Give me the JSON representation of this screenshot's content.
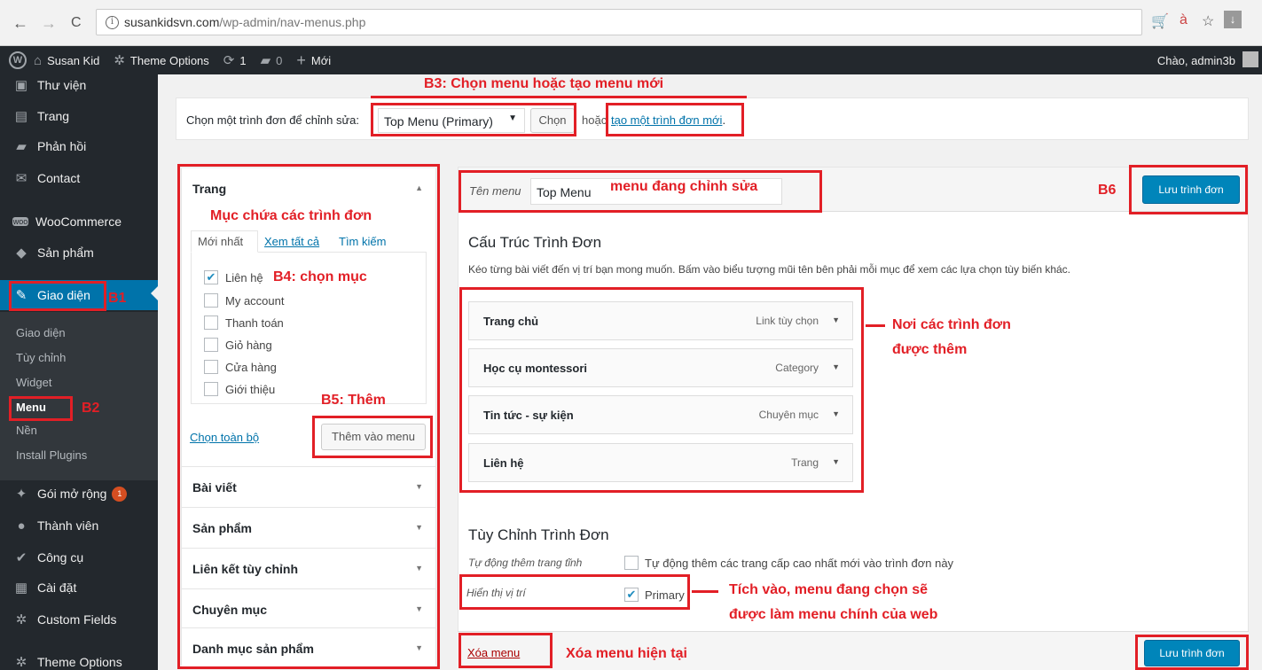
{
  "browser": {
    "back": "←",
    "forward": "→",
    "reload": "C",
    "info": "i",
    "url_host": "susankidsvn.com",
    "url_path": "/wp-admin/nav-menus.php"
  },
  "adminbar": {
    "site_name": "Susan Kid",
    "theme_options": "Theme Options",
    "updates": "1",
    "comments": "0",
    "new_label": "Mới",
    "greeting": "Chào, admin3b"
  },
  "sidebar": {
    "items": [
      {
        "label": "Thư viện",
        "icon": "media-icon"
      },
      {
        "label": "Trang",
        "icon": "page-icon"
      },
      {
        "label": "Phản hồi",
        "icon": "comment-icon"
      },
      {
        "label": "Contact",
        "icon": "mail-icon"
      },
      {
        "label": "WooCommerce",
        "icon": "woo-icon"
      },
      {
        "label": "Sản phẩm",
        "icon": "product-icon"
      },
      {
        "label": "Giao diện",
        "icon": "brush-icon"
      },
      {
        "label": "Gói mở rộng",
        "icon": "plugin-icon"
      },
      {
        "label": "Thành viên",
        "icon": "users-icon"
      },
      {
        "label": "Công cụ",
        "icon": "wrench-icon"
      },
      {
        "label": "Cài đặt",
        "icon": "settings-icon"
      },
      {
        "label": "Custom Fields",
        "icon": "gear-icon"
      },
      {
        "label": "Theme Options",
        "icon": "gear-icon"
      }
    ],
    "plugins_badge": "1",
    "submenu": [
      "Giao diện",
      "Tùy chỉnh",
      "Widget",
      "Menu",
      "Nền",
      "Install Plugins"
    ]
  },
  "select_bar": {
    "label": "Chọn một trình đơn để chỉnh sửa:",
    "selected": "Top Menu (Primary)",
    "button": "Chọn",
    "or_text": "hoặc",
    "create_link": "tạo một trình đơn mới",
    "period": "."
  },
  "left_panel": {
    "pages_title": "Trang",
    "tabs": [
      "Mới nhất",
      "Xem tất cả",
      "Tìm kiếm"
    ],
    "pages": [
      {
        "label": "Liên hệ",
        "checked": true
      },
      {
        "label": "My account",
        "checked": false
      },
      {
        "label": "Thanh toán",
        "checked": false
      },
      {
        "label": "Giỏ hàng",
        "checked": false
      },
      {
        "label": "Cửa hàng",
        "checked": false
      },
      {
        "label": "Giới thiệu",
        "checked": false
      }
    ],
    "select_all": "Chọn toàn bộ",
    "add_button": "Thêm vào menu",
    "sections": [
      "Bài viết",
      "Sản phẩm",
      "Liên kết tùy chỉnh",
      "Chuyên mục",
      "Danh mục sản phẩm"
    ]
  },
  "right_panel": {
    "menu_name_label": "Tên menu",
    "menu_name_value": "Top Menu",
    "save_button": "Lưu trình đơn",
    "structure_title": "Cấu Trúc Trình Đơn",
    "structure_desc": "Kéo từng bài viết đến vị trí bạn mong muốn. Bấm vào biểu tượng mũi tên bên phải mỗi mục để xem các lựa chọn tùy biến khác.",
    "menu_items": [
      {
        "title": "Trang chủ",
        "type": "Link tùy chọn"
      },
      {
        "title": "Học cụ montessori",
        "type": "Category"
      },
      {
        "title": "Tin tức - sự kiện",
        "type": "Chuyên mục"
      },
      {
        "title": "Liên hệ",
        "type": "Trang"
      }
    ],
    "settings_title": "Tùy Chỉnh Trình Đơn",
    "auto_add_label": "Tự động thêm trang tĩnh",
    "auto_add_text": "Tự động thêm các trang cấp cao nhất mới vào trình đơn này",
    "location_label": "Hiển thị vị trí",
    "location_primary": "Primary",
    "delete_link": "Xóa menu"
  },
  "annotations": {
    "b3": "B3: Chọn menu hoặc tạo menu mới",
    "container": "Mục chứa các trình đơn",
    "b4": "B4: chọn mục",
    "b5": "B5: Thêm",
    "editing": "menu đang chỉnh sửa",
    "b6": "B6",
    "b1": "B1",
    "b2": "B2",
    "added_line1": "Nơi các trình đơn",
    "added_line2": "được thêm",
    "tick_line1": "Tích vào, menu đang chọn sẽ",
    "tick_line2": "được làm menu chính của web",
    "delete": "Xóa menu hiện tại"
  },
  "colors": {
    "annotation": "#e21f26",
    "admin_dark": "#23282d",
    "wp_blue": "#0073aa",
    "button_blue": "#0085ba"
  }
}
